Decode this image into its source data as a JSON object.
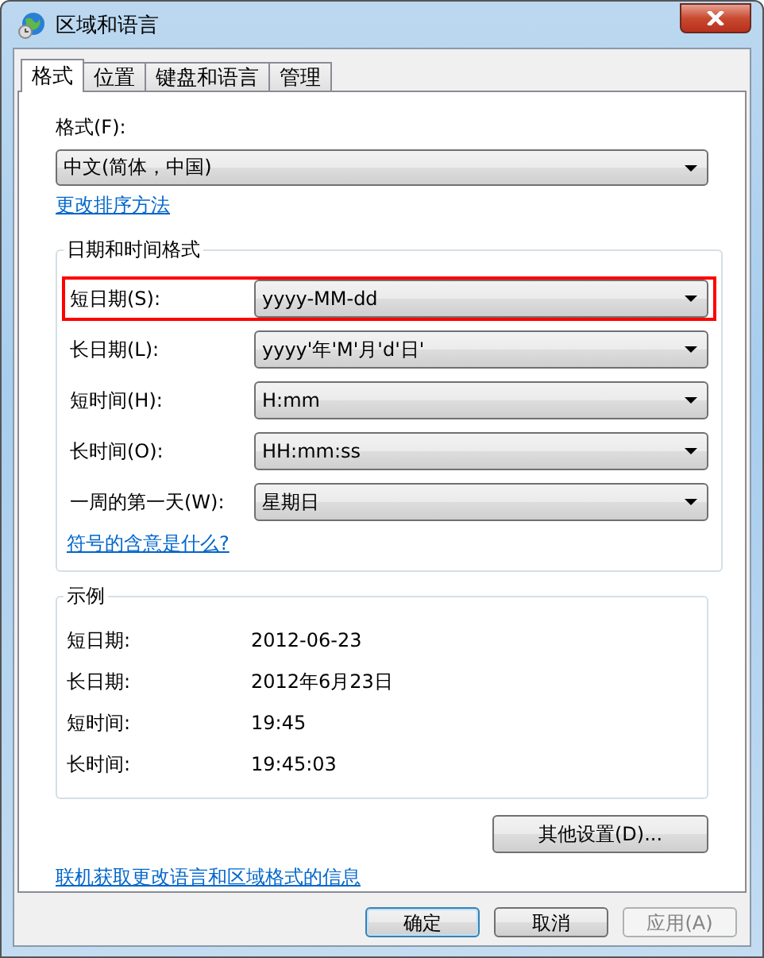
{
  "window": {
    "title": "区域和语言"
  },
  "tabs": [
    {
      "label": "格式",
      "selected": true
    },
    {
      "label": "位置",
      "selected": false
    },
    {
      "label": "键盘和语言",
      "selected": false
    },
    {
      "label": "管理",
      "selected": false
    }
  ],
  "format": {
    "label": "格式(F):",
    "value": "中文(简体，中国)",
    "link": "更改排序方法"
  },
  "date_time_group": {
    "title": "日期和时间格式",
    "rows": [
      {
        "label": "短日期(S):",
        "value": "yyyy-MM-dd",
        "highlighted": true
      },
      {
        "label": "长日期(L):",
        "value": "yyyy'年'M'月'd'日'",
        "highlighted": false
      },
      {
        "label": "短时间(H):",
        "value": "H:mm",
        "highlighted": false
      },
      {
        "label": "长时间(O):",
        "value": "HH:mm:ss",
        "highlighted": false
      },
      {
        "label": "一周的第一天(W):",
        "value": "星期日",
        "highlighted": false
      }
    ],
    "link": "符号的含意是什么?"
  },
  "example_group": {
    "title": "示例",
    "rows": [
      {
        "label": "短日期:",
        "value": "2012-06-23"
      },
      {
        "label": "长日期:",
        "value": "2012年6月23日"
      },
      {
        "label": "短时间:",
        "value": "19:45"
      },
      {
        "label": "长时间:",
        "value": "19:45:03"
      }
    ]
  },
  "other_settings_button": "其他设置(D)...",
  "online_link": "联机获取更改语言和区域格式的信息",
  "buttons": [
    {
      "label": "确定",
      "disabled": false,
      "default": true
    },
    {
      "label": "取消",
      "disabled": false,
      "default": false
    },
    {
      "label": "应用(A)",
      "disabled": true,
      "default": false
    }
  ]
}
